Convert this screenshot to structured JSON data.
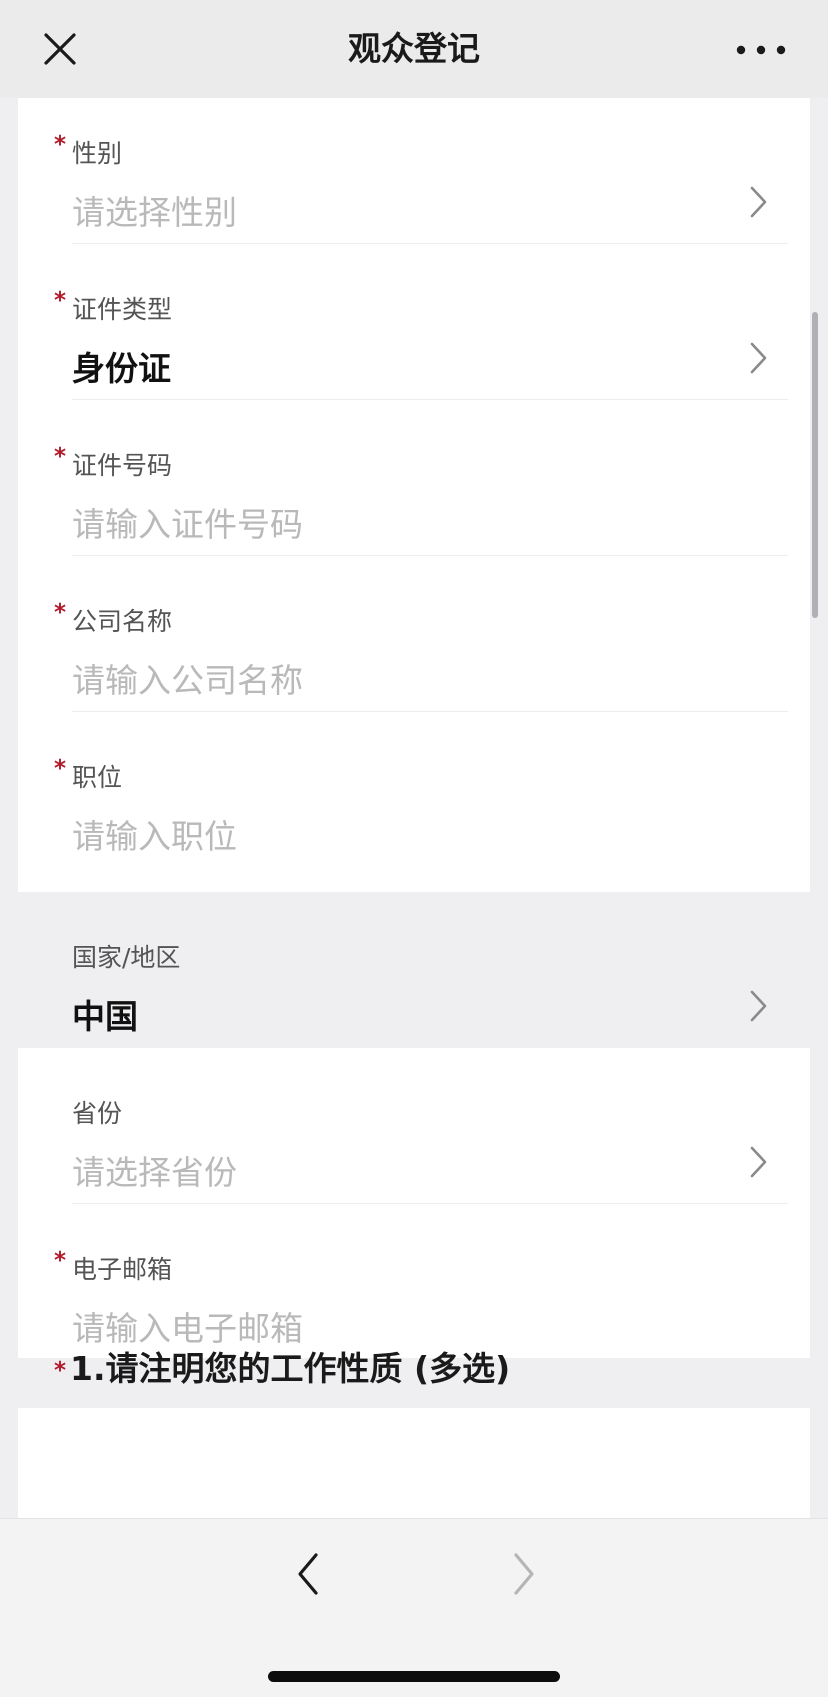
{
  "header": {
    "title": "观众登记",
    "close_icon": "close-icon",
    "more_icon": "more-icon"
  },
  "fields": [
    {
      "label": "性别",
      "required": true,
      "value": "请选择性别",
      "is_placeholder": true,
      "type": "select"
    },
    {
      "label": "证件类型",
      "required": true,
      "value": "身份证",
      "is_placeholder": false,
      "type": "select"
    },
    {
      "label": "证件号码",
      "required": true,
      "value": "请输入证件号码",
      "is_placeholder": true,
      "type": "input"
    },
    {
      "label": "公司名称",
      "required": true,
      "value": "请输入公司名称",
      "is_placeholder": true,
      "type": "input"
    },
    {
      "label": "职位",
      "required": true,
      "value": "请输入职位",
      "is_placeholder": true,
      "type": "input"
    },
    {
      "label": "国家/地区",
      "required": false,
      "value": "中国",
      "is_placeholder": false,
      "type": "select"
    },
    {
      "label": "省份",
      "required": false,
      "value": "请选择省份",
      "is_placeholder": true,
      "type": "select"
    },
    {
      "label": "电子邮箱",
      "required": true,
      "value": "请输入电子邮箱",
      "is_placeholder": true,
      "type": "input"
    }
  ],
  "required_mark": "*",
  "question": {
    "text": "1.请注明您的工作性质 (多选)",
    "required": true
  },
  "footer": {
    "back_icon": "chevron-left-icon",
    "forward_icon": "chevron-right-icon",
    "forward_enabled": false
  },
  "colors": {
    "required": "#b21a2c",
    "placeholder": "#b9b9b9",
    "label": "#545454",
    "background": "#efeff2"
  }
}
